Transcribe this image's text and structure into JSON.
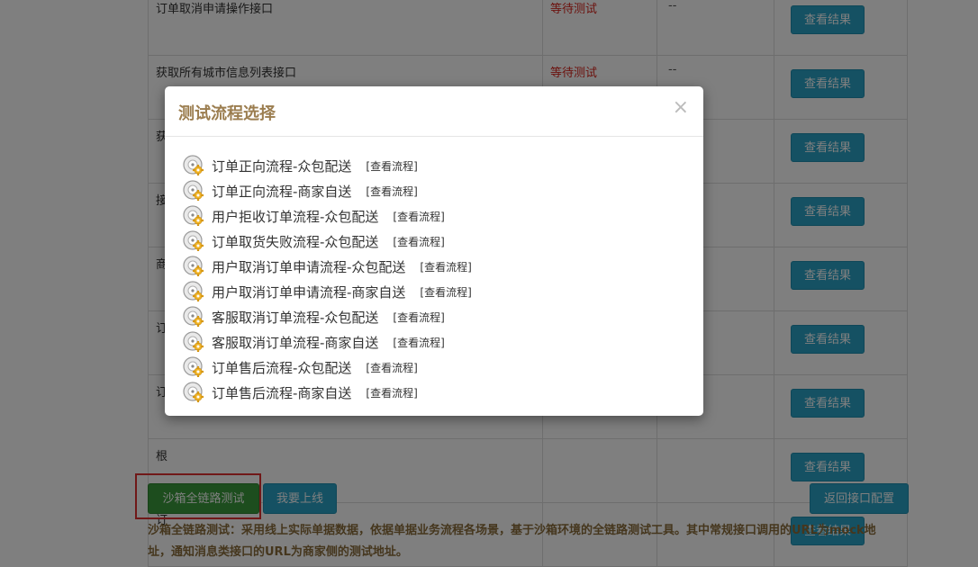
{
  "table": {
    "result_button_label": "查看结果",
    "rows": [
      {
        "name": "订单取消申请操作接口",
        "status": "等待测试",
        "result": "--"
      },
      {
        "name": "获取所有城市信息列表接口",
        "status": "等待测试",
        "result": "--"
      },
      {
        "name": "获",
        "status": "",
        "result": ""
      },
      {
        "name": "接",
        "status": "",
        "result": ""
      },
      {
        "name": "商",
        "status": "",
        "result": ""
      },
      {
        "name": "订",
        "status": "",
        "result": ""
      },
      {
        "name": "订",
        "status": "",
        "result": ""
      },
      {
        "name": "根",
        "status": "",
        "result": ""
      },
      {
        "name": "订",
        "status": "",
        "result": ""
      }
    ]
  },
  "actions": {
    "sandbox_label": "沙箱全链路测试",
    "online_label": "我要上线",
    "back_label": "返回接口配置"
  },
  "description": "沙箱全链路测试：采用线上实际单据数据，依据单据业务流程各场景，基于沙箱环境的全链路测试工具。其中常规接口调用的URL为mock地址，通知消息类接口的URL为商家侧的测试地址。",
  "modal": {
    "title": "测试流程选择",
    "close": "×",
    "link_label": "[查看流程]",
    "flows": [
      "订单正向流程-众包配送",
      "订单正向流程-商家自送",
      "用户拒收订单流程-众包配送",
      "订单取货失败流程-众包配送",
      "用户取消订单申请流程-众包配送",
      "用户取消订单申请流程-商家自送",
      "客服取消订单流程-众包配送",
      "客服取消订单流程-商家自送",
      "订单售后流程-众包配送",
      "订单售后流程-商家自送"
    ]
  },
  "icons": {
    "flow_item": "gear-disc-icon"
  },
  "colors": {
    "primary_button": "#2aa3c7",
    "success_button": "#3a9b3c",
    "status_pending": "#d9251d",
    "modal_title": "#9b7d4f",
    "highlight": "#e03131"
  }
}
